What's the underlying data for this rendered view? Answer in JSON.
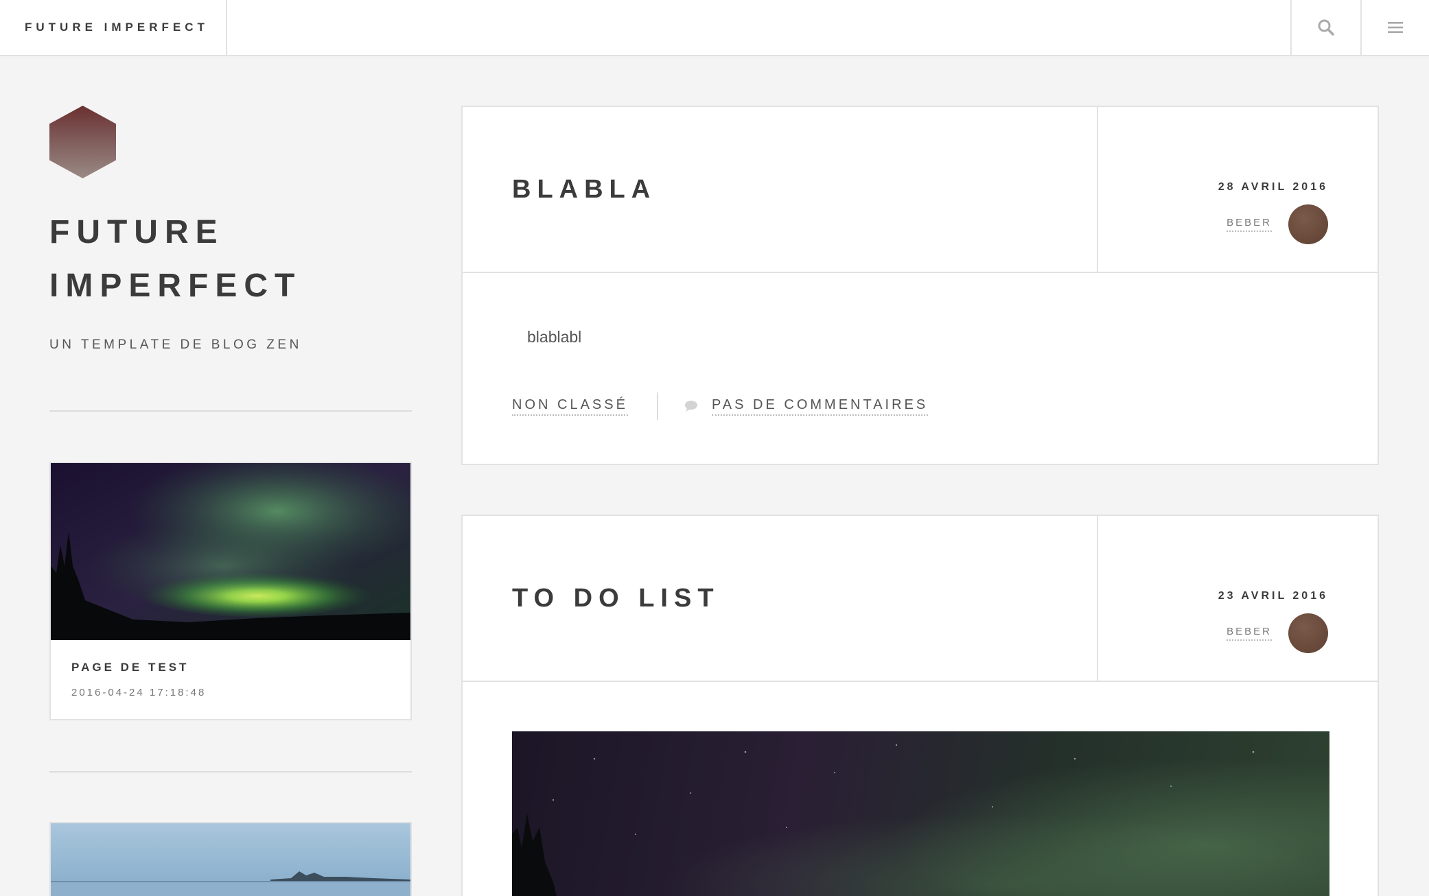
{
  "header": {
    "brand": "FUTURE IMPERFECT",
    "icons": {
      "search": "search-icon",
      "menu": "hamburger-menu-icon"
    }
  },
  "sidebar": {
    "title_line1": "FUTURE",
    "title_line2": "IMPERFECT",
    "tagline": "UN TEMPLATE DE BLOG ZEN",
    "mini_posts": [
      {
        "title": "PAGE DE TEST",
        "date": "2016-04-24 17:18:48"
      }
    ]
  },
  "posts": [
    {
      "title": "BLABLA",
      "date": "28 AVRIL 2016",
      "author": "BEBER",
      "excerpt": "blablabl",
      "category": "NON CLASSÉ",
      "comments": "PAS DE COMMENTAIRES"
    },
    {
      "title": "TO DO LIST",
      "date": "23 AVRIL 2016",
      "author": "BEBER"
    }
  ],
  "colors": {
    "background": "#f4f4f4",
    "card": "#ffffff",
    "border": "#e2e2e2",
    "text": "#3c3b3b",
    "avatar": "#6b4a3a"
  }
}
